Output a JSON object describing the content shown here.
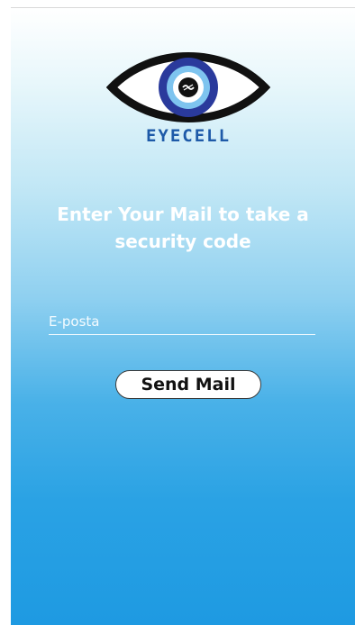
{
  "brand": {
    "name": "EYECELL",
    "logo_icon": "eye-icon"
  },
  "headline": "Enter Your Mail to take a security code",
  "email_input": {
    "placeholder": "E-posta",
    "value": ""
  },
  "send_button": {
    "label": "Send Mail"
  },
  "colors": {
    "gradient_top": "#ffffff",
    "gradient_bottom": "#1e9ae2",
    "brand_blue": "#1e5aa8"
  }
}
